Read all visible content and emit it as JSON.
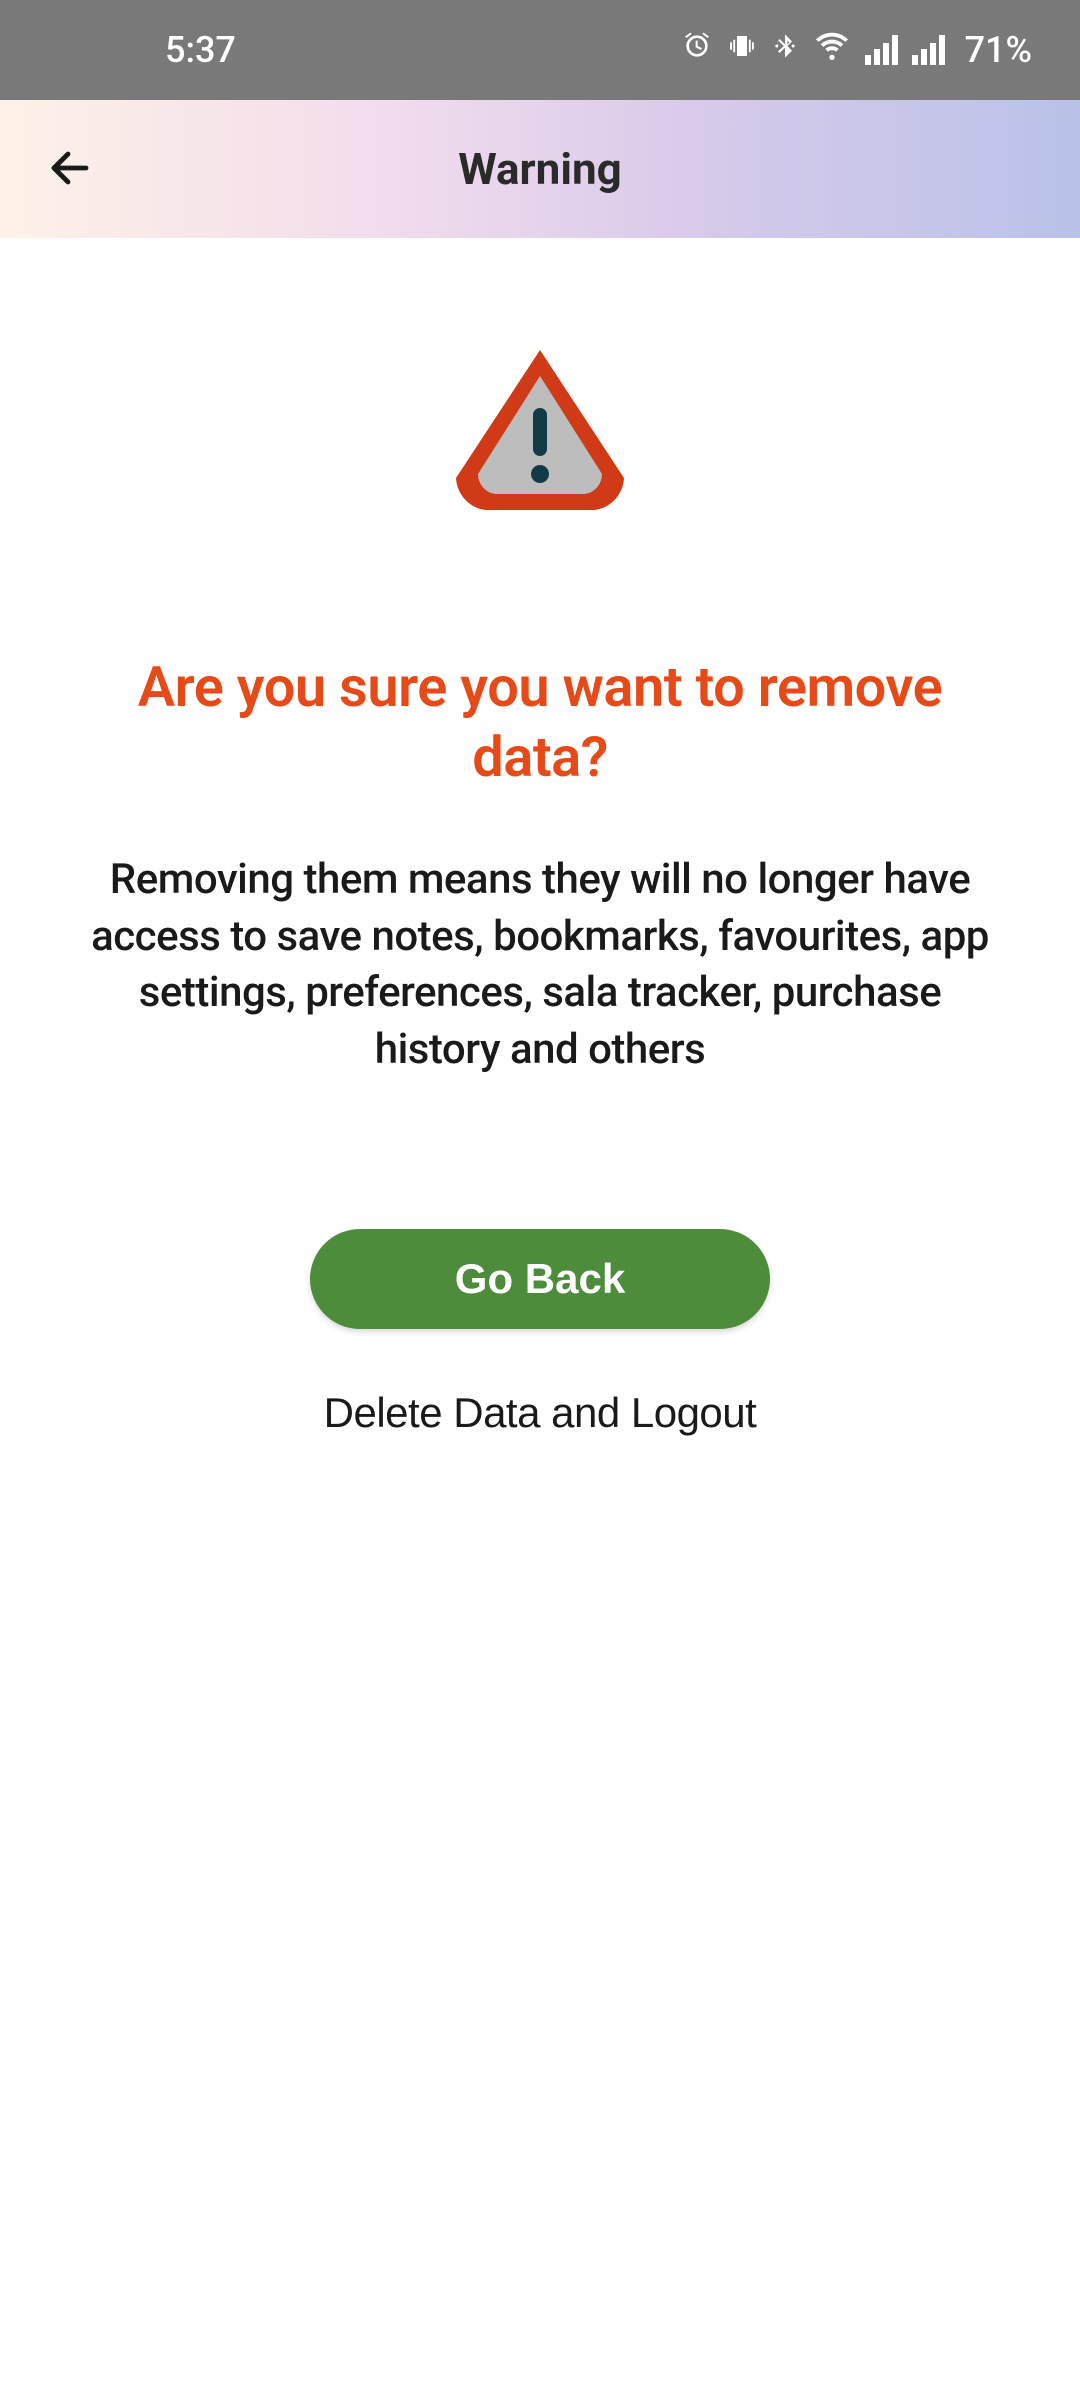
{
  "status": {
    "time": "5:37",
    "battery": "71%"
  },
  "header": {
    "title": "Warning"
  },
  "main": {
    "heading": "Are you sure you want to remove data?",
    "body": "Removing them means they will no longer have access to save notes, bookmarks, favourites, app settings, preferences, sala tracker, purchase history and others",
    "primary_button": "Go Back",
    "secondary_button": "Delete Data and Logout"
  },
  "colors": {
    "accent_red": "#e64a19",
    "button_green": "#4d8c3a",
    "status_gray": "#797979"
  }
}
